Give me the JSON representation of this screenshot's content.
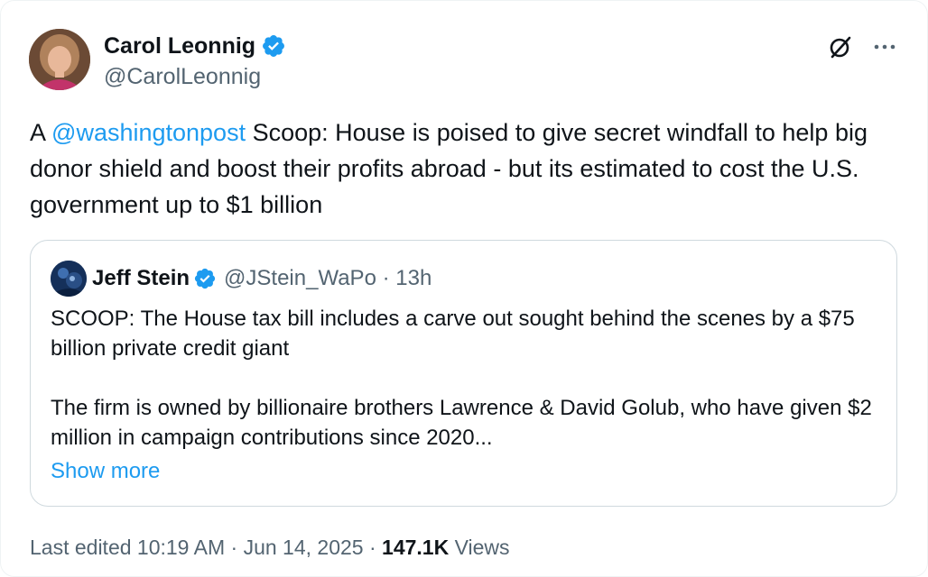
{
  "author": {
    "name": "Carol Leonnig",
    "handle": "@CarolLeonnig",
    "avatar_icon": "avatar-photo"
  },
  "header_actions": {
    "grok_icon": "grok-slash-icon",
    "more_icon": "more-horizontal-icon"
  },
  "tweet": {
    "prefix": "A ",
    "mention": "@washingtonpost",
    "body": " Scoop: House is poised to give secret windfall to help big donor shield and boost their profits abroad - but its estimated to cost the U.S. government up to $1 billion"
  },
  "quote": {
    "name": "Jeff Stein",
    "handle": "@JStein_WaPo",
    "separator": " · ",
    "time": "13h",
    "paragraph1": "SCOOP: The House tax bill includes a carve out sought behind the scenes by a $75 billion private credit giant",
    "paragraph2": "The firm is owned by billionaire brothers Lawrence & David Golub, who have given $2 million in campaign contributions since 2020...",
    "show_more": "Show more"
  },
  "meta": {
    "edited_label": "Last edited ",
    "time": "10:19 AM",
    "sep1": " · ",
    "date": "Jun 14, 2025",
    "sep2": " · ",
    "views_count": "147.1K",
    "views_label": " Views"
  },
  "colors": {
    "accent": "#1d9bf0",
    "text_primary": "#0f1419",
    "text_secondary": "#536471",
    "border": "#cfd9de"
  }
}
